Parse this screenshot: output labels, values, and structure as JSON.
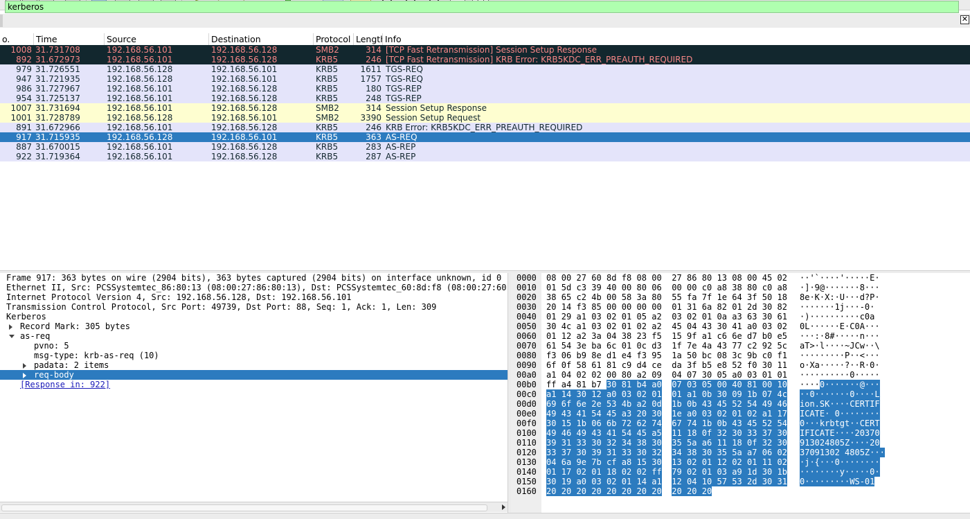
{
  "filter": {
    "value": "kerberos"
  },
  "columns": [
    "o.",
    "Time",
    "Source",
    "Destination",
    "Protocol",
    "Length",
    "Info"
  ],
  "packets": [
    {
      "no": "1008",
      "time": "31.731708",
      "src": "192.168.56.101",
      "dst": "192.168.56.128",
      "proto": "SMB2",
      "len": "314",
      "info": "[TCP Fast Retransmission] Session Setup Response",
      "style": "dark"
    },
    {
      "no": "892",
      "time": "31.672973",
      "src": "192.168.56.101",
      "dst": "192.168.56.128",
      "proto": "KRB5",
      "len": "246",
      "info": "[TCP Fast Retransmission] KRB Error: KRB5KDC_ERR_PREAUTH_REQUIRED",
      "style": "dark"
    },
    {
      "no": "979",
      "time": "31.726551",
      "src": "192.168.56.128",
      "dst": "192.168.56.101",
      "proto": "KRB5",
      "len": "1611",
      "info": "TGS-REQ",
      "style": "krb"
    },
    {
      "no": "947",
      "time": "31.721935",
      "src": "192.168.56.128",
      "dst": "192.168.56.101",
      "proto": "KRB5",
      "len": "1757",
      "info": "TGS-REQ",
      "style": "krb"
    },
    {
      "no": "986",
      "time": "31.727967",
      "src": "192.168.56.101",
      "dst": "192.168.56.128",
      "proto": "KRB5",
      "len": "180",
      "info": "TGS-REP",
      "style": "krb"
    },
    {
      "no": "954",
      "time": "31.725137",
      "src": "192.168.56.101",
      "dst": "192.168.56.128",
      "proto": "KRB5",
      "len": "248",
      "info": "TGS-REP",
      "style": "krb"
    },
    {
      "no": "1007",
      "time": "31.731694",
      "src": "192.168.56.101",
      "dst": "192.168.56.128",
      "proto": "SMB2",
      "len": "314",
      "info": "Session Setup Response",
      "style": "smb"
    },
    {
      "no": "1001",
      "time": "31.728789",
      "src": "192.168.56.128",
      "dst": "192.168.56.101",
      "proto": "SMB2",
      "len": "3390",
      "info": "Session Setup Request",
      "style": "smb"
    },
    {
      "no": "891",
      "time": "31.672966",
      "src": "192.168.56.101",
      "dst": "192.168.56.128",
      "proto": "KRB5",
      "len": "246",
      "info": "KRB Error: KRB5KDC_ERR_PREAUTH_REQUIRED",
      "style": "krb"
    },
    {
      "no": "917",
      "time": "31.715935",
      "src": "192.168.56.128",
      "dst": "192.168.56.101",
      "proto": "KRB5",
      "len": "363",
      "info": "AS-REQ",
      "style": "sel"
    },
    {
      "no": "887",
      "time": "31.670015",
      "src": "192.168.56.101",
      "dst": "192.168.56.128",
      "proto": "KRB5",
      "len": "283",
      "info": "AS-REP",
      "style": "krb"
    },
    {
      "no": "922",
      "time": "31.719364",
      "src": "192.168.56.101",
      "dst": "192.168.56.128",
      "proto": "KRB5",
      "len": "287",
      "info": "AS-REP",
      "style": "krb"
    }
  ],
  "details": [
    {
      "text": "Frame 917: 363 bytes on wire (2904 bits), 363 bytes captured (2904 bits) on interface unknown, id 0",
      "level": 0,
      "tri": "none"
    },
    {
      "text": "Ethernet II, Src: PCSSystemtec_86:80:13 (08:00:27:86:80:13), Dst: PCSSystemtec_60:8d:f8 (08:00:27:60:",
      "level": 0,
      "tri": "none"
    },
    {
      "text": "Internet Protocol Version 4, Src: 192.168.56.128, Dst: 192.168.56.101",
      "level": 0,
      "tri": "none"
    },
    {
      "text": "Transmission Control Protocol, Src Port: 49739, Dst Port: 88, Seq: 1, Ack: 1, Len: 309",
      "level": 0,
      "tri": "none"
    },
    {
      "text": "Kerberos",
      "level": 0,
      "tri": "none"
    },
    {
      "text": "Record Mark: 305 bytes",
      "level": 1,
      "tri": "right"
    },
    {
      "text": "as-req",
      "level": 1,
      "tri": "down"
    },
    {
      "text": "pvno: 5",
      "level": 2,
      "tri": "none"
    },
    {
      "text": "msg-type: krb-as-req (10)",
      "level": 2,
      "tri": "none"
    },
    {
      "text": "padata: 2 items",
      "level": 2,
      "tri": "right"
    },
    {
      "text": "req-body",
      "level": 2,
      "tri": "right",
      "selected": true
    },
    {
      "text": "[Response in: 922]",
      "level": 1,
      "tri": "none",
      "link": true
    }
  ],
  "hexdump": [
    {
      "off": "0000",
      "hex": [
        "08",
        "00",
        "27",
        "60",
        "8d",
        "f8",
        "08",
        "00",
        "27",
        "86",
        "80",
        "13",
        "08",
        "00",
        "45",
        "02"
      ],
      "ascii": "··'`····'·····E·"
    },
    {
      "off": "0010",
      "hex": [
        "01",
        "5d",
        "c3",
        "39",
        "40",
        "00",
        "80",
        "06",
        "00",
        "00",
        "c0",
        "a8",
        "38",
        "80",
        "c0",
        "a8"
      ],
      "ascii": "·]·9@·······8···"
    },
    {
      "off": "0020",
      "hex": [
        "38",
        "65",
        "c2",
        "4b",
        "00",
        "58",
        "3a",
        "80",
        "55",
        "fa",
        "7f",
        "1e",
        "64",
        "3f",
        "50",
        "18"
      ],
      "ascii": "8e·K·X:·U···d?P·"
    },
    {
      "off": "0030",
      "hex": [
        "20",
        "14",
        "f3",
        "85",
        "00",
        "00",
        "00",
        "00",
        "01",
        "31",
        "6a",
        "82",
        "01",
        "2d",
        "30",
        "82"
      ],
      "ascii": " ·······1j···-0·"
    },
    {
      "off": "0040",
      "hex": [
        "01",
        "29",
        "a1",
        "03",
        "02",
        "01",
        "05",
        "a2",
        "03",
        "02",
        "01",
        "0a",
        "a3",
        "63",
        "30",
        "61"
      ],
      "ascii": "·)··········c0a"
    },
    {
      "off": "0050",
      "hex": [
        "30",
        "4c",
        "a1",
        "03",
        "02",
        "01",
        "02",
        "a2",
        "45",
        "04",
        "43",
        "30",
        "41",
        "a0",
        "03",
        "02"
      ],
      "ascii": "0L······E·C0A···"
    },
    {
      "off": "0060",
      "hex": [
        "01",
        "12",
        "a2",
        "3a",
        "04",
        "38",
        "23",
        "f5",
        "15",
        "9f",
        "a1",
        "c6",
        "6e",
        "d7",
        "b0",
        "e5"
      ],
      "ascii": "···:·8#·····n···"
    },
    {
      "off": "0070",
      "hex": [
        "61",
        "54",
        "3e",
        "ba",
        "6c",
        "01",
        "0c",
        "d3",
        "1f",
        "7e",
        "4a",
        "43",
        "77",
        "c2",
        "92",
        "5c"
      ],
      "ascii": "aT>·l····~JCw··\\"
    },
    {
      "off": "0080",
      "hex": [
        "f3",
        "06",
        "b9",
        "8e",
        "d1",
        "e4",
        "f3",
        "95",
        "1a",
        "50",
        "bc",
        "08",
        "3c",
        "9b",
        "c0",
        "f1"
      ],
      "ascii": "·········P··<···"
    },
    {
      "off": "0090",
      "hex": [
        "6f",
        "0f",
        "58",
        "61",
        "81",
        "c9",
        "d4",
        "ce",
        "da",
        "3f",
        "b5",
        "e8",
        "52",
        "f0",
        "30",
        "11"
      ],
      "ascii": "o·Xa·····?··R·0·"
    },
    {
      "off": "00a0",
      "hex": [
        "a1",
        "04",
        "02",
        "02",
        "00",
        "80",
        "a2",
        "09",
        "04",
        "07",
        "30",
        "05",
        "a0",
        "03",
        "01",
        "01"
      ],
      "ascii": "··········0·····"
    },
    {
      "off": "00b0",
      "hex": [
        "ff",
        "a4",
        "81",
        "b7",
        "30",
        "81",
        "b4",
        "a0",
        "07",
        "03",
        "05",
        "00",
        "40",
        "81",
        "00",
        "10"
      ],
      "ascii": "····0·······@···",
      "hlFrom": 4
    },
    {
      "off": "00c0",
      "hex": [
        "a1",
        "14",
        "30",
        "12",
        "a0",
        "03",
        "02",
        "01",
        "01",
        "a1",
        "0b",
        "30",
        "09",
        "1b",
        "07",
        "4c"
      ],
      "ascii": "··0·······0····L",
      "hlFrom": 0
    },
    {
      "off": "00d0",
      "hex": [
        "69",
        "6f",
        "6e",
        "2e",
        "53",
        "4b",
        "a2",
        "0d",
        "1b",
        "0b",
        "43",
        "45",
        "52",
        "54",
        "49",
        "46"
      ],
      "ascii": "ion.SK····CERTIF",
      "hlFrom": 0
    },
    {
      "off": "00e0",
      "hex": [
        "49",
        "43",
        "41",
        "54",
        "45",
        "a3",
        "20",
        "30",
        "1e",
        "a0",
        "03",
        "02",
        "01",
        "02",
        "a1",
        "17"
      ],
      "ascii": "ICATE· 0········",
      "hlFrom": 0
    },
    {
      "off": "00f0",
      "hex": [
        "30",
        "15",
        "1b",
        "06",
        "6b",
        "72",
        "62",
        "74",
        "67",
        "74",
        "1b",
        "0b",
        "43",
        "45",
        "52",
        "54"
      ],
      "ascii": "0···krbtgt··CERT",
      "hlFrom": 0
    },
    {
      "off": "0100",
      "hex": [
        "49",
        "46",
        "49",
        "43",
        "41",
        "54",
        "45",
        "a5",
        "11",
        "18",
        "0f",
        "32",
        "30",
        "33",
        "37",
        "30"
      ],
      "ascii": "IFICATE····20370",
      "hlFrom": 0
    },
    {
      "off": "0110",
      "hex": [
        "39",
        "31",
        "33",
        "30",
        "32",
        "34",
        "38",
        "30",
        "35",
        "5a",
        "a6",
        "11",
        "18",
        "0f",
        "32",
        "30"
      ],
      "ascii": "913024805Z····20",
      "hlFrom": 0
    },
    {
      "off": "0120",
      "hex": [
        "33",
        "37",
        "30",
        "39",
        "31",
        "33",
        "30",
        "32",
        "34",
        "38",
        "30",
        "35",
        "5a",
        "a7",
        "06",
        "02"
      ],
      "ascii": "37091302 4805Z···",
      "hlFrom": 0
    },
    {
      "off": "0130",
      "hex": [
        "04",
        "6a",
        "9e",
        "7b",
        "cf",
        "a8",
        "15",
        "30",
        "13",
        "02",
        "01",
        "12",
        "02",
        "01",
        "11",
        "02"
      ],
      "ascii": "·j·{···0········",
      "hlFrom": 0
    },
    {
      "off": "0140",
      "hex": [
        "01",
        "17",
        "02",
        "01",
        "18",
        "02",
        "02",
        "ff",
        "79",
        "02",
        "01",
        "03",
        "a9",
        "1d",
        "30",
        "1b"
      ],
      "ascii": "········y·····0·",
      "hlFrom": 0
    },
    {
      "off": "0150",
      "hex": [
        "30",
        "19",
        "a0",
        "03",
        "02",
        "01",
        "14",
        "a1",
        "12",
        "04",
        "10",
        "57",
        "53",
        "2d",
        "30",
        "31"
      ],
      "ascii": "0·········WS-01",
      "hlFrom": 0
    },
    {
      "off": "0160",
      "hex": [
        "20",
        "20",
        "20",
        "20",
        "20",
        "20",
        "20",
        "20",
        "20",
        "20",
        "20"
      ],
      "ascii": "           ",
      "hlFrom": 0
    }
  ]
}
